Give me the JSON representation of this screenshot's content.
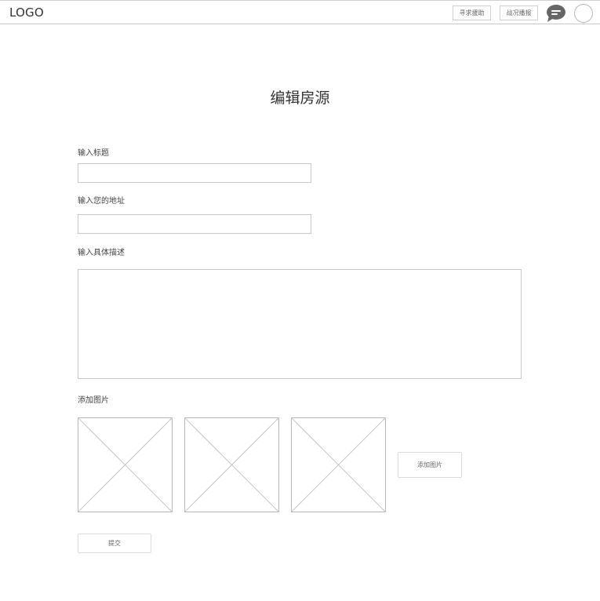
{
  "header": {
    "logo": "LOGO",
    "nav": {
      "help_label": "寻求援助",
      "report_label": "战况播报"
    },
    "icons": {
      "chat": "chat-bubble-icon",
      "avatar": "user-avatar"
    }
  },
  "page": {
    "title": "编辑房源"
  },
  "form": {
    "title_label": "输入标题",
    "title_value": "",
    "address_label": "输入您的地址",
    "address_value": "",
    "description_label": "输入具体描述",
    "description_value": "",
    "images_label": "添加图片",
    "add_image_button": "添加图片",
    "submit_button": "提交"
  }
}
